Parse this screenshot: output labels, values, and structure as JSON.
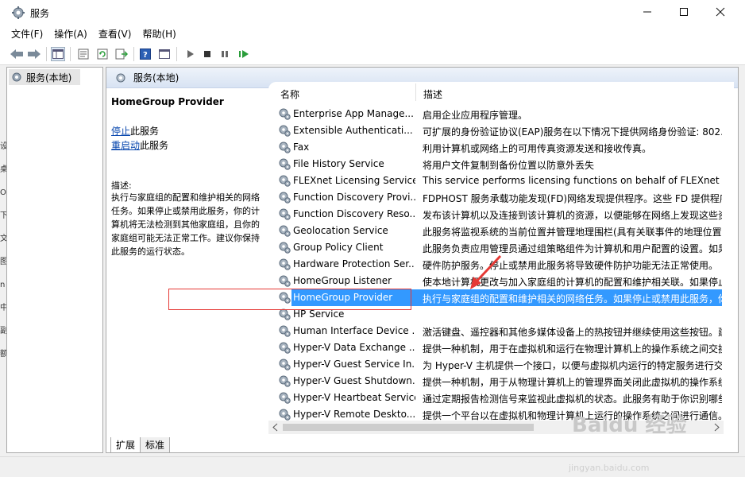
{
  "window": {
    "title": "服务"
  },
  "menu": {
    "items": [
      "文件(F)",
      "操作(A)",
      "查看(V)",
      "帮助(H)"
    ]
  },
  "tree": {
    "root_label": "服务(本地)"
  },
  "left_hint_chars": [
    "设",
    "桌",
    "O",
    "下",
    "文",
    "图",
    "n",
    "中",
    "副",
    "额"
  ],
  "panel": {
    "header": "服务(本地)",
    "selected_title": "HomeGroup Provider",
    "stop_link": "停止",
    "stop_suffix": "此服务",
    "restart_link": "重启动",
    "restart_suffix": "此服务",
    "desc_label": "描述:",
    "desc_text": "执行与家庭组的配置和维护相关的网络任务。如果停止或禁用此服务，你的计算机将无法检测到其他家庭组，且你的家庭组可能无法正常工作。建议你保持此服务的运行状态。"
  },
  "columns": {
    "name": "名称",
    "desc": "描述"
  },
  "services": [
    {
      "name": "Enterprise App Manage...",
      "desc": "启用企业应用程序管理。"
    },
    {
      "name": "Extensible Authenticati...",
      "desc": "可扩展的身份验证协议(EAP)服务在以下情况下提供网络身份验证: 802.1"
    },
    {
      "name": "Fax",
      "desc": "利用计算机或网络上的可用传真资源发送和接收传真。"
    },
    {
      "name": "File History Service",
      "desc": "将用户文件复制到备份位置以防意外丢失"
    },
    {
      "name": "FLEXnet Licensing Service",
      "desc": "This service performs licensing functions on behalf of FLEXnet en"
    },
    {
      "name": "Function Discovery Provi...",
      "desc": "FDPHOST 服务承载功能发现(FD)网络发现提供程序。这些 FD 提供程序"
    },
    {
      "name": "Function Discovery Reso...",
      "desc": "发布该计算机以及连接到该计算机的资源，以便能够在网络上发现这些资"
    },
    {
      "name": "Geolocation Service",
      "desc": "此服务将监视系统的当前位置并管理地理围栏(具有关联事件的地理位置)"
    },
    {
      "name": "Group Policy Client",
      "desc": "此服务负责应用管理员通过组策略组件为计算机和用户配置的设置。如果"
    },
    {
      "name": "Hardware Protection Ser...",
      "desc": "硬件防护服务。停止或禁用此服务将导致硬件防护功能无法正常使用。"
    },
    {
      "name": "HomeGroup Listener",
      "desc": "使本地计算机更改与加入家庭组的计算机的配置和维护相关联。如果停止"
    },
    {
      "name": "HomeGroup Provider",
      "desc": "执行与家庭组的配置和维护相关的网络任务。如果停止或禁用此服务，你"
    },
    {
      "name": "HP Service",
      "desc": ""
    },
    {
      "name": "Human Interface Device ...",
      "desc": "激活键盘、遥控器和其他多媒体设备上的热按钮并继续使用这些按钮。建"
    },
    {
      "name": "Hyper-V Data Exchange ...",
      "desc": "提供一种机制，用于在虚拟机和运行在物理计算机上的操作系统之间交换"
    },
    {
      "name": "Hyper-V Guest Service In...",
      "desc": "为 Hyper-V 主机提供一个接口，以便与虚拟机内运行的特定服务进行交"
    },
    {
      "name": "Hyper-V Guest Shutdown...",
      "desc": "提供一种机制，用于从物理计算机上的管理界面关闭此虚拟机的操作系统"
    },
    {
      "name": "Hyper-V Heartbeat Service",
      "desc": "通过定期报告检测信号来监视此虚拟机的状态。此服务有助于你识别哪些"
    },
    {
      "name": "Hyper-V Remote Deskto...",
      "desc": "提供一个平台以在虚拟机和物理计算机上运行的操作系统之间进行通信。"
    }
  ],
  "selected_index": 11,
  "tabs": [
    "扩展",
    "标准"
  ],
  "watermark": {
    "brand": "Baidu 经验",
    "url": "jingyan.baidu.com"
  },
  "colors": {
    "selection": "#3399ff",
    "redbox": "#e53935",
    "link": "#0645ad"
  }
}
